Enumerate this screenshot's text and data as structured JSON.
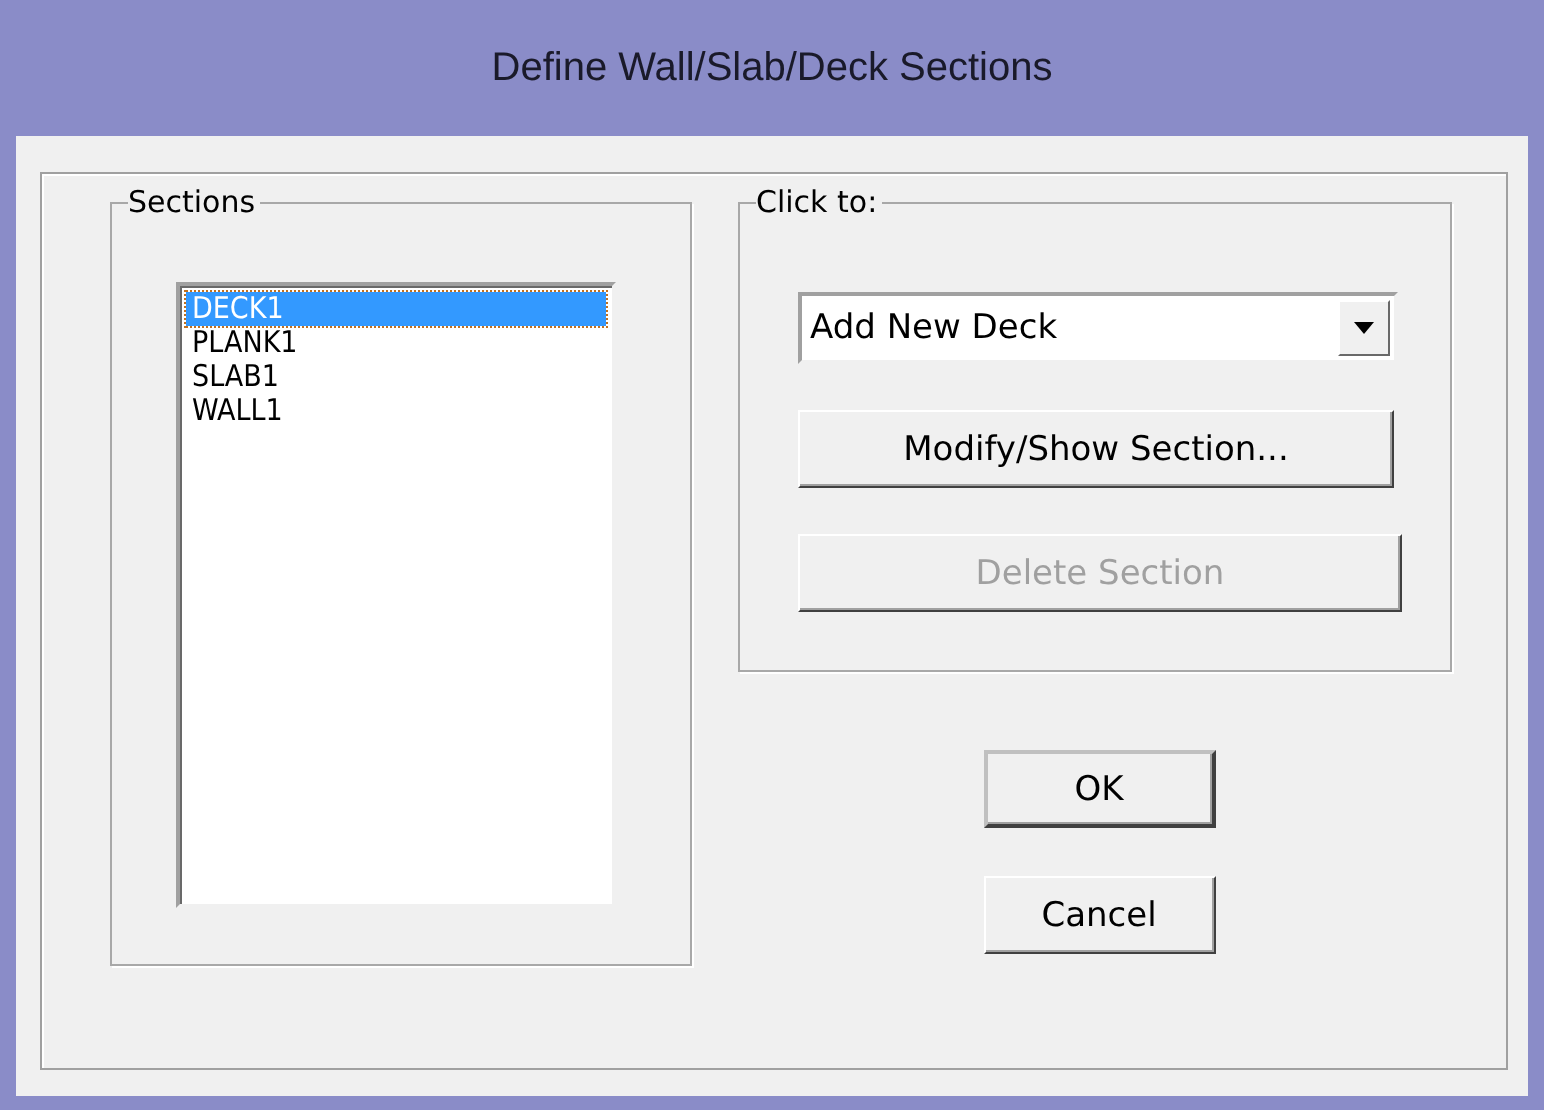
{
  "window": {
    "title": "Define Wall/Slab/Deck Sections"
  },
  "sections": {
    "label": "Sections",
    "items": [
      {
        "name": "DECK1",
        "selected": true
      },
      {
        "name": "PLANK1",
        "selected": false
      },
      {
        "name": "SLAB1",
        "selected": false
      },
      {
        "name": "WALL1",
        "selected": false
      }
    ]
  },
  "click_to": {
    "label": "Click to:",
    "dropdown": {
      "value": "Add New Deck"
    },
    "buttons": [
      {
        "label": "Modify/Show Section...",
        "disabled": false
      },
      {
        "label": "Delete Section",
        "disabled": true
      }
    ]
  },
  "buttons": [
    {
      "label": "OK",
      "default": true
    },
    {
      "label": "Cancel",
      "default": false
    }
  ]
}
